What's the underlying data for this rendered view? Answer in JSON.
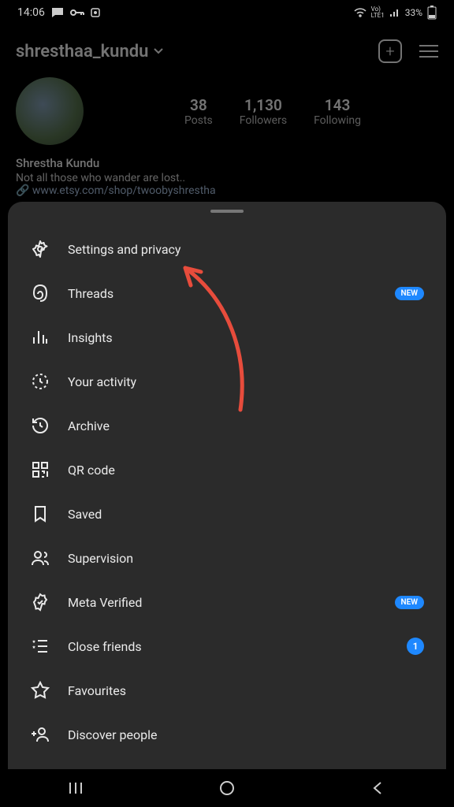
{
  "status": {
    "time": "14:06",
    "battery": "33%",
    "network": "LTE1"
  },
  "profile": {
    "username": "shresthaa_kundu",
    "display_name": "Shrestha Kundu",
    "bio": "Not all those who wander are lost..",
    "link": "www.etsy.com/shop/twoobyshrestha",
    "stats": {
      "posts_value": "38",
      "posts_label": "Posts",
      "followers_value": "1,130",
      "followers_label": "Followers",
      "following_value": "143",
      "following_label": "Following"
    }
  },
  "menu": {
    "items": [
      {
        "label": "Settings and privacy",
        "icon": "gear"
      },
      {
        "label": "Threads",
        "icon": "threads",
        "badge_new": "NEW"
      },
      {
        "label": "Insights",
        "icon": "bar-chart"
      },
      {
        "label": "Your activity",
        "icon": "clock-dashed"
      },
      {
        "label": "Archive",
        "icon": "history"
      },
      {
        "label": "QR code",
        "icon": "qr"
      },
      {
        "label": "Saved",
        "icon": "bookmark"
      },
      {
        "label": "Supervision",
        "icon": "people"
      },
      {
        "label": "Meta Verified",
        "icon": "verified",
        "badge_new": "NEW"
      },
      {
        "label": "Close friends",
        "icon": "list-star",
        "badge_count": "1"
      },
      {
        "label": "Favourites",
        "icon": "star"
      },
      {
        "label": "Discover people",
        "icon": "add-user"
      }
    ]
  }
}
